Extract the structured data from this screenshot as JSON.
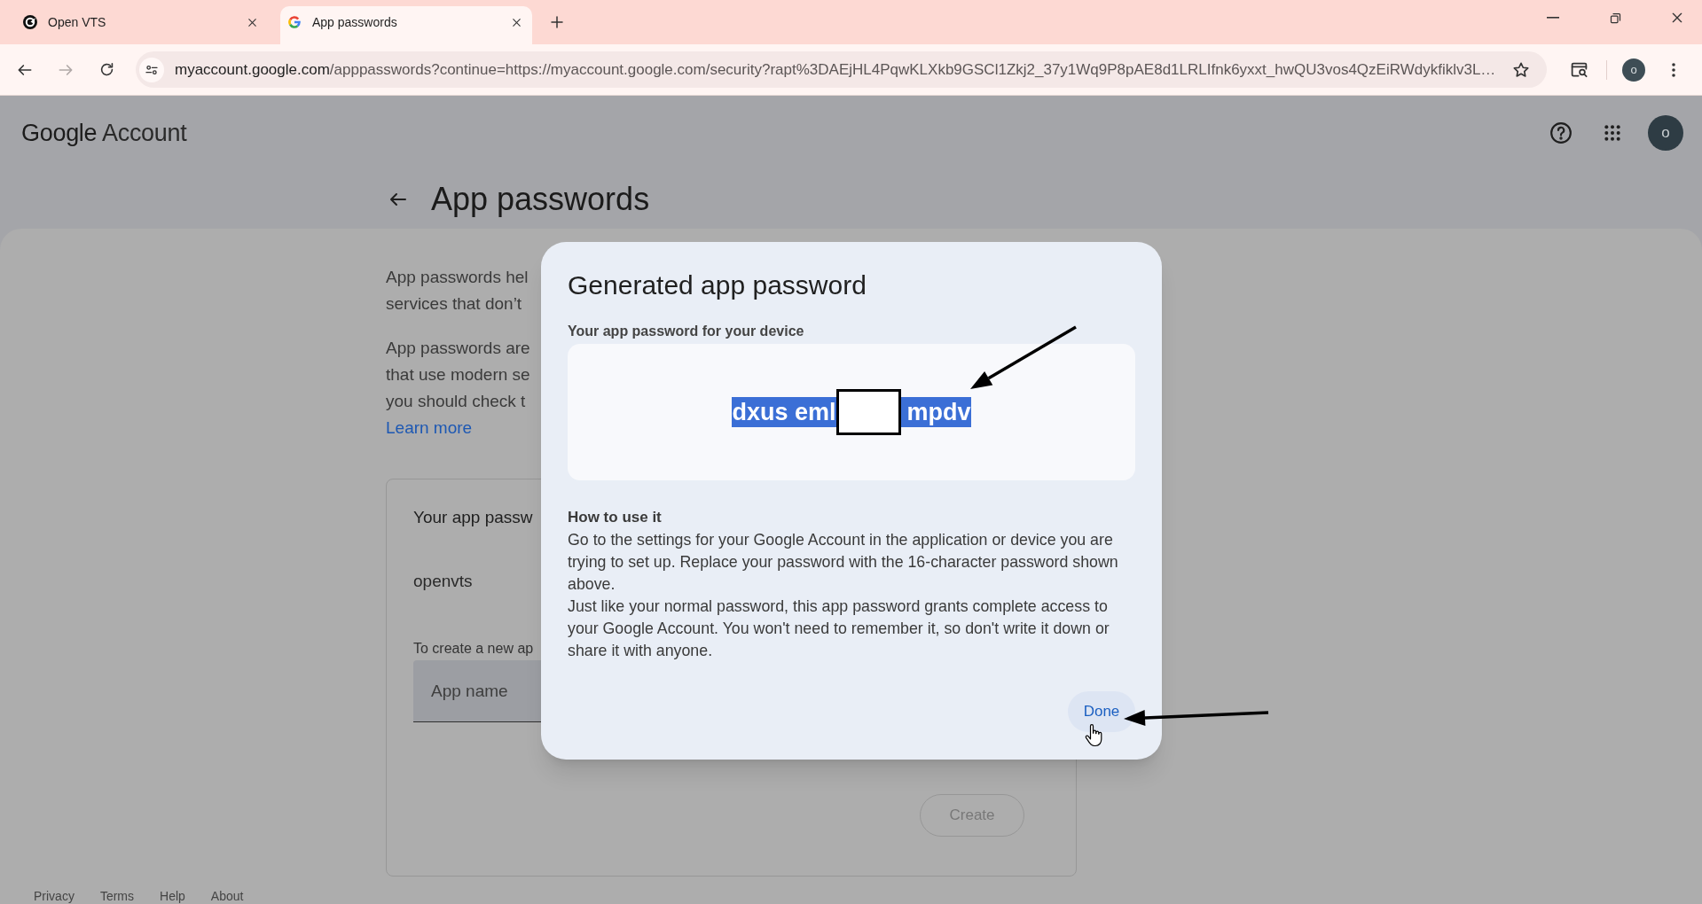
{
  "browser": {
    "tabs": [
      {
        "title": "Open VTS",
        "selected": false
      },
      {
        "title": "App passwords",
        "selected": true
      }
    ],
    "address_bar": {
      "host": "myaccount.google.com",
      "path": "/apppasswords?continue=https://myaccount.google.com/security?rapt%3DAEjHL4PqwKLXkb9GSCl1Zkj2_37y1Wq9P8pAE8d1LRLIfnk6yxxt_hwQU3vos4QzEiRWdykfiklv3L…"
    },
    "profile_initial": "o"
  },
  "header": {
    "logo": {
      "brand": "Google",
      "product": "Account"
    },
    "avatar_initial": "o"
  },
  "page": {
    "title": "App passwords",
    "intro_paragraphs": [
      [
        "App passwords hel",
        "services that don’t"
      ],
      [
        "App passwords are",
        "that use modern se",
        "you should check t"
      ]
    ],
    "learn_more": "Learn more",
    "app_passwords_card": {
      "title": "Your app passw",
      "apps": [
        "openvts"
      ],
      "create_hint": "To create a new ap",
      "app_name_field": {
        "placeholder": "App name"
      },
      "create_button": {
        "label": "Create",
        "disabled": true
      }
    },
    "footer_links": [
      "Privacy",
      "Terms",
      "Help",
      "About"
    ]
  },
  "dialog": {
    "title": "Generated app password",
    "password_label": "Your app password for your device",
    "password": {
      "visible_start": "dxus eml",
      "visible_end": "mpdv",
      "selected": true
    },
    "how_to_heading": "How to use it",
    "how_to_paragraphs": [
      "Go to the settings for your Google Account in the application or device you are trying to set up. Replace your password with the 16-character password shown above.",
      "Just like your normal password, this app password grants complete access to your Google Account. You won't need to remember it, so don't write it down or share it with anyone."
    ],
    "done_button": "Done"
  }
}
